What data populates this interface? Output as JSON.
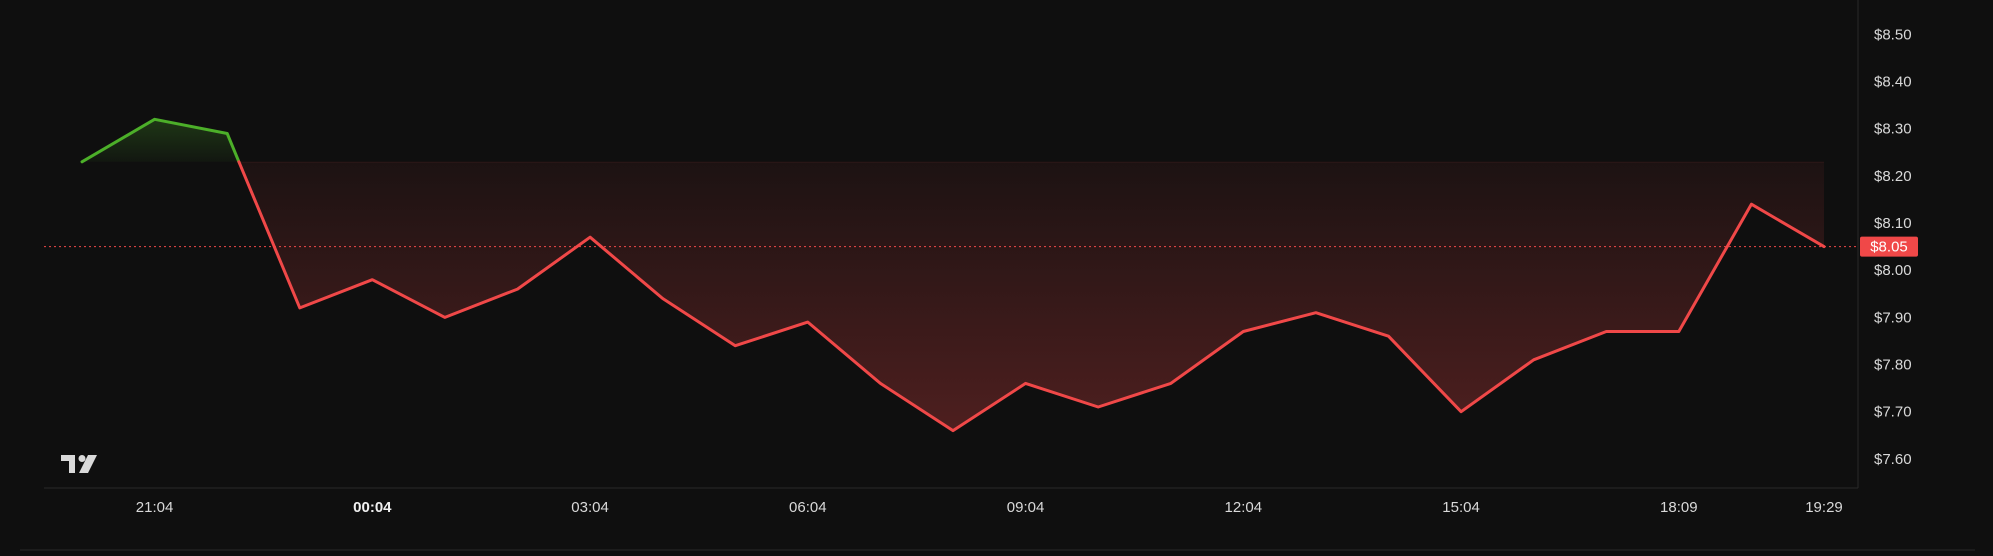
{
  "chart_data": {
    "type": "line",
    "x": [
      "20:04",
      "21:04",
      "22:04",
      "23:04",
      "00:04",
      "01:04",
      "02:04",
      "03:04",
      "04:04",
      "05:04",
      "06:04",
      "07:04",
      "08:04",
      "09:04",
      "10:04",
      "11:04",
      "12:04",
      "13:04",
      "14:04",
      "15:04",
      "16:04",
      "17:04",
      "18:09",
      "19:04",
      "19:29"
    ],
    "values": [
      8.23,
      8.32,
      8.29,
      7.92,
      7.98,
      7.9,
      7.96,
      8.07,
      7.94,
      7.84,
      7.89,
      7.76,
      7.66,
      7.76,
      7.71,
      7.76,
      7.87,
      7.91,
      7.86,
      7.7,
      7.81,
      7.87,
      7.87,
      8.14,
      8.05
    ],
    "baseline": 8.23,
    "current_price": 8.05,
    "current_price_label": "$8.05",
    "ylim": [
      7.57,
      8.52
    ],
    "yticks": [
      7.6,
      7.7,
      7.8,
      7.9,
      8.0,
      8.1,
      8.2,
      8.3,
      8.4,
      8.5
    ],
    "ytick_labels": [
      "$7.60",
      "$7.70",
      "$7.80",
      "$7.90",
      "$8.00",
      "$8.10",
      "$8.20",
      "$8.30",
      "$8.40",
      "$8.50"
    ],
    "xtick_labels": [
      {
        "label": "21:04",
        "index": 1,
        "bold": false
      },
      {
        "label": "00:04",
        "index": 4,
        "bold": true
      },
      {
        "label": "03:04",
        "index": 7,
        "bold": false
      },
      {
        "label": "06:04",
        "index": 10,
        "bold": false
      },
      {
        "label": "09:04",
        "index": 13,
        "bold": false
      },
      {
        "label": "12:04",
        "index": 16,
        "bold": false
      },
      {
        "label": "15:04",
        "index": 19,
        "bold": false
      },
      {
        "label": "18:09",
        "index": 22,
        "bold": false
      },
      {
        "label": "19:29",
        "index": 24,
        "bold": false
      }
    ],
    "colors": {
      "up": "#4caf29",
      "down": "#f04848",
      "background": "#0f0f0f",
      "text": "#d9d9d9"
    },
    "grid": false,
    "logo": "tradingview-logo-icon"
  }
}
